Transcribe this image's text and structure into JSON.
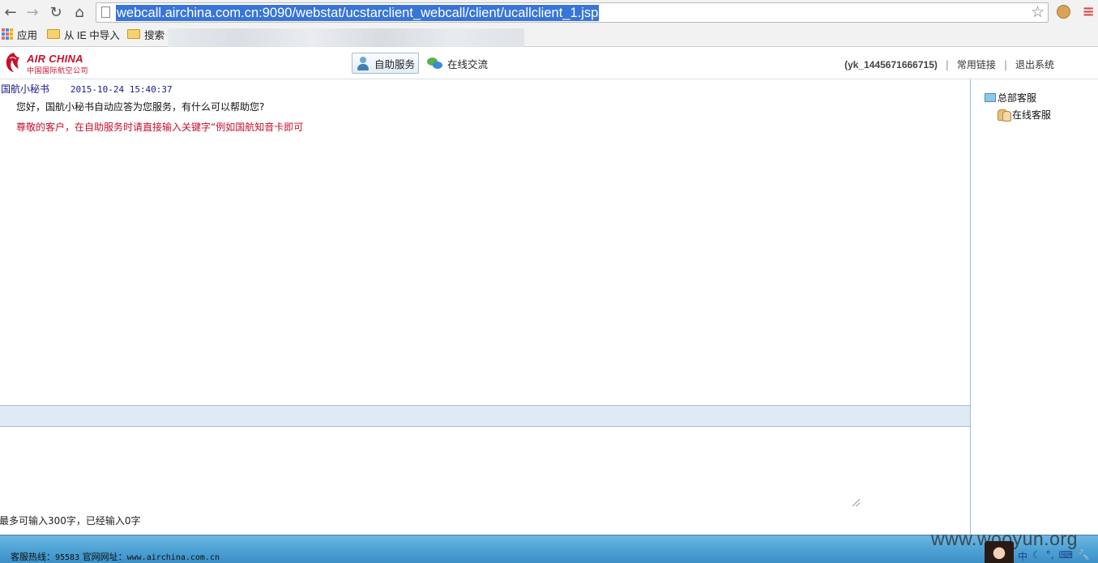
{
  "browser": {
    "url": "webcall.airchina.com.cn:9090/webstat/ucstarclient_webcall/client/ucallclient_1.jsp",
    "nav_icons": [
      "back-icon",
      "forward-icon",
      "reload-icon",
      "home-icon"
    ],
    "bookmarks": [
      {
        "label": "应用",
        "icon": "apps-icon"
      },
      {
        "label": "从 IE 中导入",
        "icon": "folder-icon"
      },
      {
        "label": "搜索",
        "icon": "folder-icon"
      }
    ]
  },
  "header": {
    "logo_text": "AIR CHINA",
    "logo_sub": "中国国际航空公司",
    "tabs": [
      {
        "label": "自助服务",
        "icon": "person-icon",
        "active": true
      },
      {
        "label": "在线交流",
        "icon": "chat-icon",
        "active": false
      }
    ],
    "user_id": "(yk_1445671666715)",
    "links": [
      "常用链接",
      "退出系统"
    ]
  },
  "chat": {
    "sender": "国航小秘书",
    "timestamp": "2015-10-24 15:40:37",
    "message": "您好，国航小秘书自动应答为您服务，有什么可以帮助您?",
    "notice": "尊敬的客户，在自助服务时请直接输入关键字“例如国航知音卡即可"
  },
  "input": {
    "value": "",
    "counter_text": "最多可输入300字，已经输入0字"
  },
  "sidebar": {
    "root": {
      "label": "总部客服",
      "icon": "folder-icon"
    },
    "children": [
      {
        "label": "在线客服",
        "icon": "users-icon"
      }
    ]
  },
  "footer": {
    "hotline_label": "客服热线：",
    "hotline": "95583",
    "site_label": "官网网址：",
    "site": "www.airchina.com.cn"
  },
  "watermark": "www.wooyun.org",
  "ime": [
    "中",
    "☾",
    "°,",
    "⌨",
    "🔧"
  ],
  "colors": {
    "brand_red": "#c8102e",
    "url_highlight": "#3875d7",
    "footer_blue": "#4ea3d6"
  }
}
